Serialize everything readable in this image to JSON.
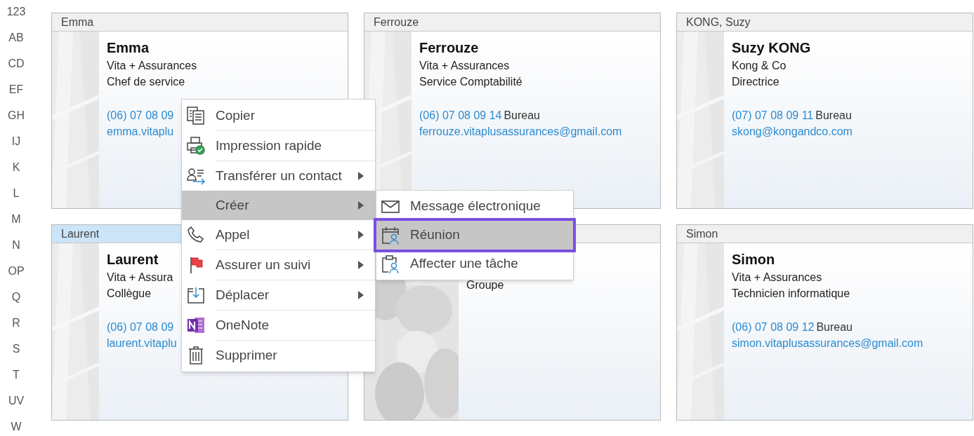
{
  "index": [
    "123",
    "AB",
    "CD",
    "EF",
    "GH",
    "IJ",
    "K",
    "L",
    "M",
    "N",
    "OP",
    "Q",
    "R",
    "S",
    "T",
    "UV",
    "W"
  ],
  "cards": [
    {
      "header": "Emma",
      "selected": false,
      "name": "Emma",
      "lines": [
        "Vita + Assurances",
        "Chef de service"
      ],
      "phone": "(06) 07 08 09",
      "email": "emma.vitaplu"
    },
    {
      "header": "Ferrouze",
      "selected": false,
      "name": "Ferrouze",
      "lines": [
        "Vita + Assurances",
        "Service Comptabilité"
      ],
      "phone": "(06) 07 08 09 14",
      "phone_label": "Bureau",
      "email": "ferrouze.vitaplusassurances@gmail.com"
    },
    {
      "header": "KONG, Suzy",
      "selected": false,
      "name": "Suzy KONG",
      "lines": [
        "Kong & Co",
        "Directrice"
      ],
      "phone": "(07) 07 08 09 11",
      "phone_label": "Bureau",
      "email": "skong@kongandco.com"
    },
    {
      "header": "Laurent",
      "selected": true,
      "name": "Laurent",
      "lines": [
        "Vita + Assura",
        "Collègue"
      ],
      "phone": "(06) 07 08 09",
      "email": "laurent.vitaplu"
    },
    {
      "selected": false,
      "kind": "picture",
      "lines": [
        "Groupe"
      ]
    },
    {
      "header": "Simon",
      "selected": false,
      "name": "Simon",
      "lines": [
        "Vita + Assurances",
        "Technicien informatique"
      ],
      "phone": "(06) 07 08 09 12",
      "phone_label": "Bureau",
      "email": "simon.vitaplusassurances@gmail.com"
    }
  ],
  "context_menu": [
    {
      "label": "Copier",
      "selected": false,
      "submenu": false
    },
    {
      "label": "Impression rapide",
      "selected": false,
      "submenu": false
    },
    {
      "label": "Transférer un contact",
      "selected": false,
      "submenu": true
    },
    {
      "label": "Créer",
      "selected": true,
      "submenu": true
    },
    {
      "label": "Appel",
      "selected": false,
      "submenu": true
    },
    {
      "label": "Assurer un suivi",
      "selected": false,
      "submenu": true
    },
    {
      "label": "Déplacer",
      "selected": false,
      "submenu": true
    },
    {
      "label": "OneNote",
      "selected": false,
      "submenu": false
    },
    {
      "label": "Supprimer",
      "selected": false,
      "submenu": false
    }
  ],
  "submenu": [
    {
      "label": "Message électronique",
      "selected": false
    },
    {
      "label": "Réunion",
      "selected": true
    },
    {
      "label": "Affecter une tâche",
      "selected": false
    }
  ]
}
